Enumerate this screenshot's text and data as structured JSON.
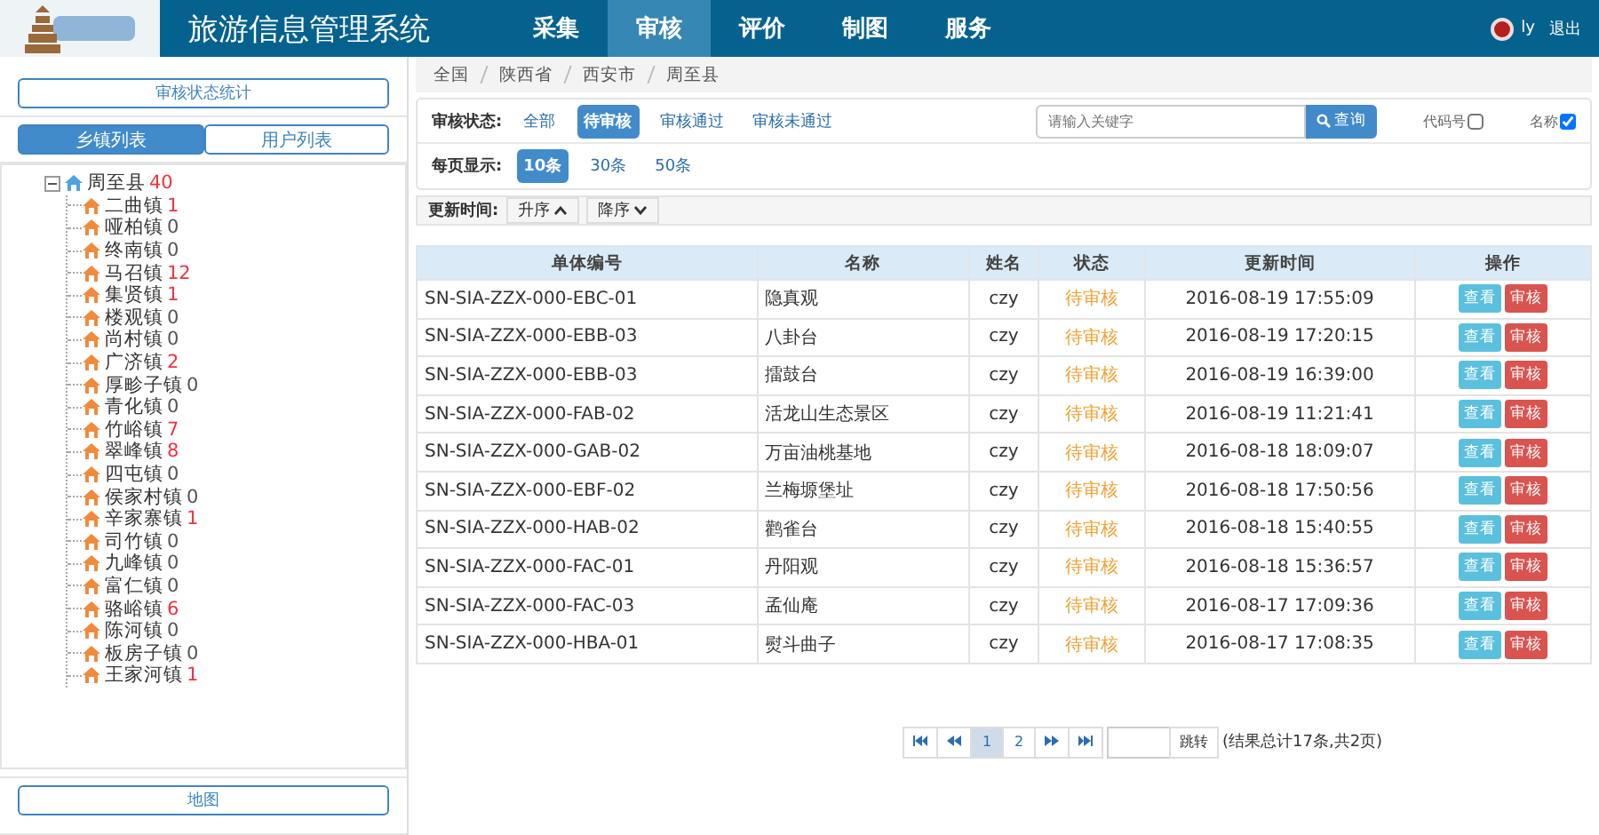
{
  "header": {
    "title": "旅游信息管理系统",
    "nav": [
      {
        "label": "采集",
        "selected": false
      },
      {
        "label": "审核",
        "selected": true
      },
      {
        "label": "评价",
        "selected": false
      },
      {
        "label": "制图",
        "selected": false
      },
      {
        "label": "服务",
        "selected": false
      }
    ],
    "user": "ly",
    "logout": "退出"
  },
  "sidebar": {
    "stats_button": "审核状态统计",
    "tabs": [
      {
        "label": "乡镇列表",
        "selected": true
      },
      {
        "label": "用户列表",
        "selected": false
      }
    ],
    "tree": {
      "label": "周至县",
      "count": "40",
      "expanded": true,
      "children": [
        {
          "label": "二曲镇",
          "count": "1"
        },
        {
          "label": "哑柏镇",
          "count": "0"
        },
        {
          "label": "终南镇",
          "count": "0"
        },
        {
          "label": "马召镇",
          "count": "12"
        },
        {
          "label": "集贤镇",
          "count": "1"
        },
        {
          "label": "楼观镇",
          "count": "0"
        },
        {
          "label": "尚村镇",
          "count": "0"
        },
        {
          "label": "广济镇",
          "count": "2"
        },
        {
          "label": "厚畛子镇",
          "count": "0"
        },
        {
          "label": "青化镇",
          "count": "0"
        },
        {
          "label": "竹峪镇",
          "count": "7"
        },
        {
          "label": "翠峰镇",
          "count": "8"
        },
        {
          "label": "四屯镇",
          "count": "0"
        },
        {
          "label": "侯家村镇",
          "count": "0"
        },
        {
          "label": "辛家寨镇",
          "count": "1"
        },
        {
          "label": "司竹镇",
          "count": "0"
        },
        {
          "label": "九峰镇",
          "count": "0"
        },
        {
          "label": "富仁镇",
          "count": "0"
        },
        {
          "label": "骆峪镇",
          "count": "6"
        },
        {
          "label": "陈河镇",
          "count": "0"
        },
        {
          "label": "板房子镇",
          "count": "0"
        },
        {
          "label": "王家河镇",
          "count": "1"
        }
      ]
    },
    "map_button": "地图"
  },
  "breadcrumb": [
    "全国",
    "陕西省",
    "西安市",
    "周至县"
  ],
  "filters": {
    "status_label": "审核状态:",
    "status_options": [
      {
        "label": "全部",
        "selected": false
      },
      {
        "label": "待审核",
        "selected": true
      },
      {
        "label": "审核通过",
        "selected": false
      },
      {
        "label": "审核未通过",
        "selected": false
      }
    ],
    "search": {
      "placeholder": "请输入关键字",
      "button": "查询"
    },
    "checks": [
      {
        "label": "代码号",
        "checked": false
      },
      {
        "label": "名称",
        "checked": true
      }
    ],
    "page_size_label": "每页显示:",
    "page_sizes": [
      {
        "label": "10条",
        "selected": true
      },
      {
        "label": "30条",
        "selected": false
      },
      {
        "label": "50条",
        "selected": false
      }
    ],
    "sort_label": "更新时间:",
    "sorts": [
      {
        "label": "升序",
        "kind": "up"
      },
      {
        "label": "降序",
        "kind": "down"
      }
    ]
  },
  "table": {
    "columns": [
      "单体编号",
      "名称",
      "姓名",
      "状态",
      "更新时间",
      "操作"
    ],
    "rows": [
      {
        "id": "SN-SIA-ZZX-000-EBC-01",
        "name": "隐真观",
        "user": "czy",
        "status": "待审核",
        "time": "2016-08-19 17:55:09",
        "view": "查看",
        "review": "审核"
      },
      {
        "id": "SN-SIA-ZZX-000-EBB-03",
        "name": "八卦台",
        "user": "czy",
        "status": "待审核",
        "time": "2016-08-19 17:20:15",
        "view": "查看",
        "review": "审核"
      },
      {
        "id": "SN-SIA-ZZX-000-EBB-03",
        "name": "擂鼓台",
        "user": "czy",
        "status": "待审核",
        "time": "2016-08-19 16:39:00",
        "view": "查看",
        "review": "审核"
      },
      {
        "id": "SN-SIA-ZZX-000-FAB-02",
        "name": "活龙山生态景区",
        "user": "czy",
        "status": "待审核",
        "time": "2016-08-19 11:21:41",
        "view": "查看",
        "review": "审核"
      },
      {
        "id": "SN-SIA-ZZX-000-GAB-02",
        "name": "万亩油桃基地",
        "user": "czy",
        "status": "待审核",
        "time": "2016-08-18 18:09:07",
        "view": "查看",
        "review": "审核"
      },
      {
        "id": "SN-SIA-ZZX-000-EBF-02",
        "name": "兰梅塬堡址",
        "user": "czy",
        "status": "待审核",
        "time": "2016-08-18 17:50:56",
        "view": "查看",
        "review": "审核"
      },
      {
        "id": "SN-SIA-ZZX-000-HAB-02",
        "name": "鹳雀台",
        "user": "czy",
        "status": "待审核",
        "time": "2016-08-18 15:40:55",
        "view": "查看",
        "review": "审核"
      },
      {
        "id": "SN-SIA-ZZX-000-FAC-01",
        "name": "丹阳观",
        "user": "czy",
        "status": "待审核",
        "time": "2016-08-18 15:36:57",
        "view": "查看",
        "review": "审核"
      },
      {
        "id": "SN-SIA-ZZX-000-FAC-03",
        "name": "孟仙庵",
        "user": "czy",
        "status": "待审核",
        "time": "2016-08-17 17:09:36",
        "view": "查看",
        "review": "审核"
      },
      {
        "id": "SN-SIA-ZZX-000-HBA-01",
        "name": "熨斗曲子",
        "user": "czy",
        "status": "待审核",
        "time": "2016-08-17 17:08:35",
        "view": "查看",
        "review": "审核"
      }
    ]
  },
  "pagination": {
    "pages": [
      {
        "label": "1",
        "selected": true
      },
      {
        "label": "2",
        "selected": false
      }
    ],
    "jump": "跳转",
    "summary": "(结果总计17条,共2页)"
  }
}
